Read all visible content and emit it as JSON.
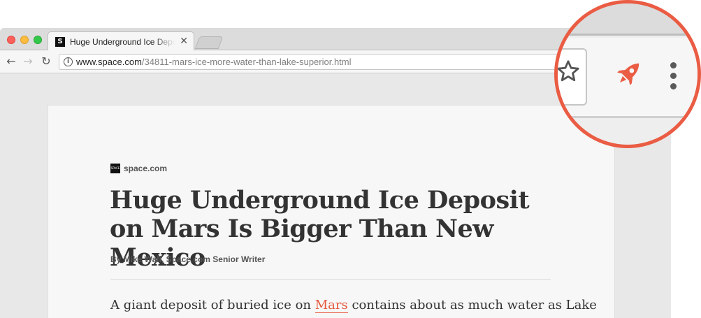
{
  "browser": {
    "tab": {
      "favicon_letter": "S",
      "title": "Huge Underground Ice Deposit on Mars Is Bigger Than New Mexico",
      "close_glyph": "✕"
    },
    "toolbar": {
      "back_glyph": "←",
      "forward_glyph": "→",
      "reload_glyph": "↻",
      "info_glyph": "i",
      "url_domain": "www.space.com",
      "url_path": "/34811-mars-ice-more-water-than-lake-superior.html"
    },
    "icons": {
      "back": "back-arrow-icon",
      "forward": "forward-arrow-icon",
      "reload": "reload-icon",
      "info": "info-icon",
      "bookmark": "star-icon",
      "extension": "rocket-icon",
      "menu": "kebab-menu-icon"
    }
  },
  "article": {
    "source_logo_text": "SPACE",
    "source": "space.com",
    "headline": "Huge Underground Ice Deposit on Mars Is Bigger Than New Mexico",
    "byline": "By Mike Wall, Space.com Senior Writer",
    "lead_before": "A giant deposit of buried ice on ",
    "lead_link": "Mars",
    "lead_after": " contains about as much water as Lake"
  },
  "colors": {
    "accent": "#ea5c43",
    "link": "#e5583d",
    "traffic_close": "#fc605b",
    "traffic_minimize": "#fdbc40",
    "traffic_maximize": "#34c84a"
  }
}
